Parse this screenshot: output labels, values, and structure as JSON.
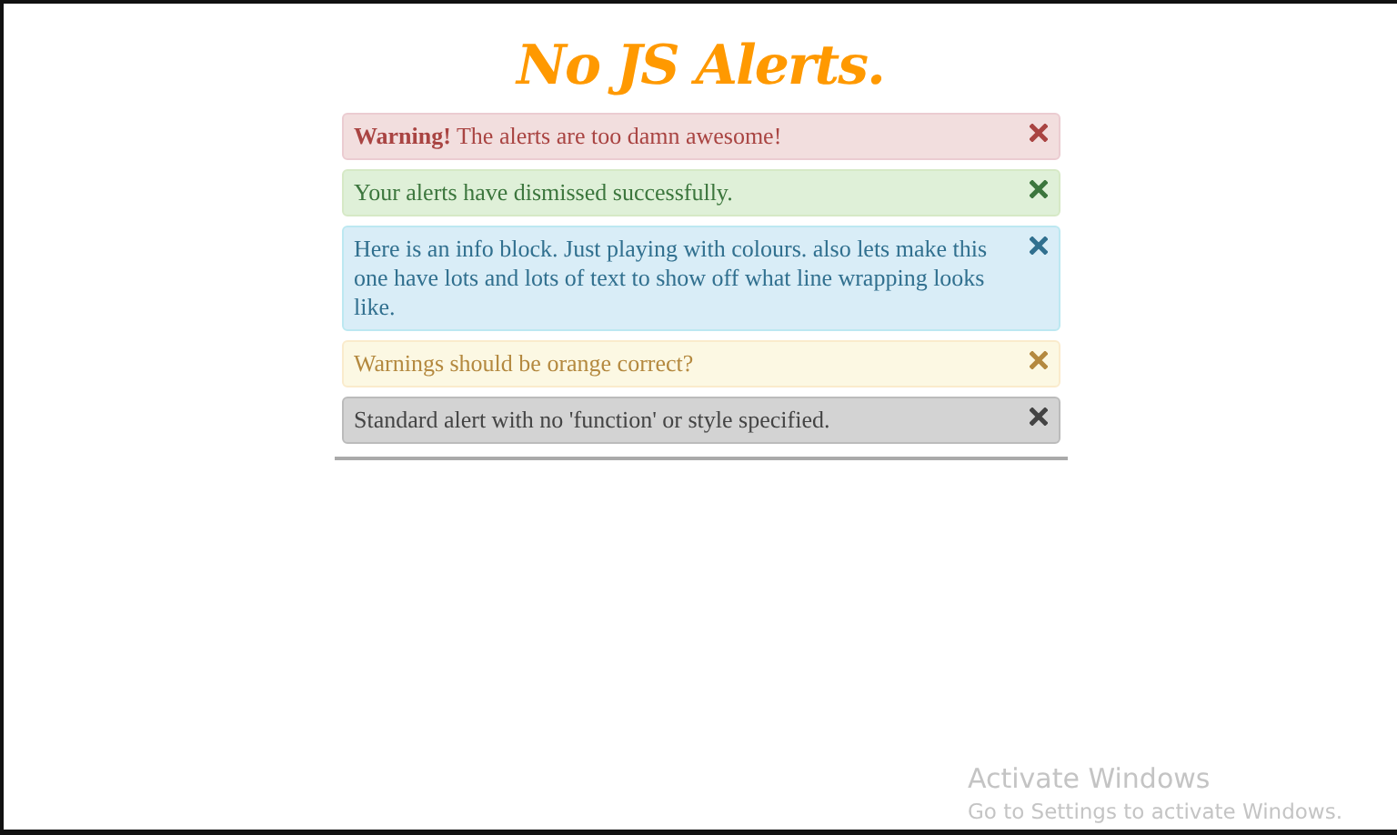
{
  "title": "No JS Alerts.",
  "alerts": [
    {
      "kind": "danger",
      "text": "**Warning!** The alerts are too damn awesome!"
    },
    {
      "kind": "success",
      "text": "Your alerts have dismissed successfully."
    },
    {
      "kind": "info",
      "text": "Here is an info block. Just playing with colours. also lets make this one have lots and lots of text to show off what line wrapping looks like."
    },
    {
      "kind": "warning",
      "text": "Warnings should be orange correct?"
    },
    {
      "kind": "default",
      "text": "Standard alert with no 'function' or style specified."
    }
  ],
  "activation": {
    "title": "Activate Windows",
    "subtitle": "Go to Settings to activate Windows."
  }
}
